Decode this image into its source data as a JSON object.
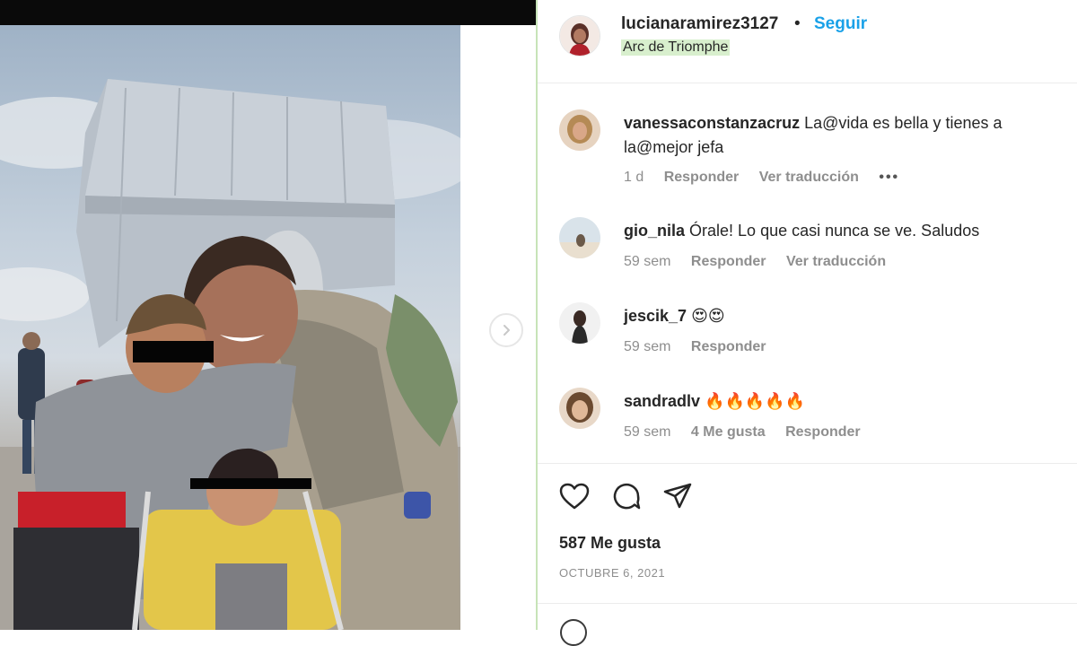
{
  "post": {
    "username": "lucianaramirez3127",
    "separator": "•",
    "follow_label": "Seguir",
    "location": "Arc de Triomphe"
  },
  "comments": [
    {
      "username": "vanessaconstanzacruz",
      "text": "La@vida es bella y tienes a la@mejor jefa",
      "time": "1 d",
      "reply_label": "Responder",
      "translate_label": "Ver traducción",
      "more": "•••"
    },
    {
      "username": "gio_nila",
      "text": "Órale! Lo que casi nunca se ve. Saludos",
      "time": "59 sem",
      "reply_label": "Responder",
      "translate_label": "Ver traducción"
    },
    {
      "username": "jescik_7",
      "text": "😍😍",
      "time": "59 sem",
      "reply_label": "Responder"
    },
    {
      "username": "sandradlv",
      "text": "🔥🔥🔥🔥🔥",
      "time": "59 sem",
      "likes": "4 Me gusta",
      "reply_label": "Responder"
    }
  ],
  "action_icons": [
    "heart-icon",
    "comment-icon",
    "share-icon"
  ],
  "likes_count": "587 Me gusta",
  "date": "OCTUBRE 6, 2021",
  "colors": {
    "follow_blue": "#1aa1e8",
    "location_highlight": "#d8efcd",
    "meta_gray": "#8e8e8e"
  }
}
